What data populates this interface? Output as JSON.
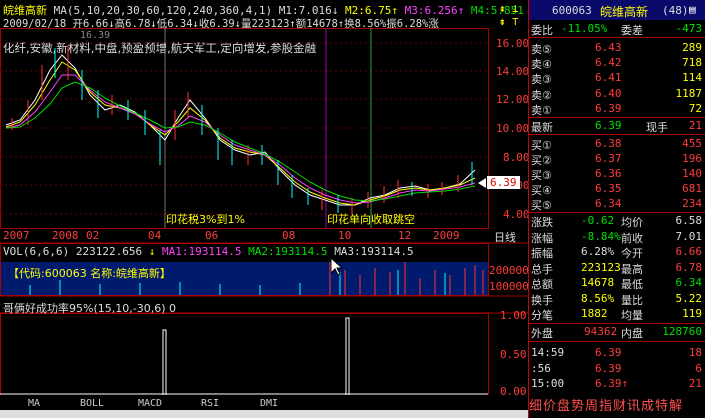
{
  "header": {
    "stock_name": "皖维高新",
    "ma_label": "MA(5,10,20,30,60,120,240,360,4,1)",
    "m1": "M1:7.016↓",
    "m2": "M2:6.75↑",
    "m3": "M3:6.256↑",
    "m4": "M4:5.851",
    "line2": "2009/02/18 开6.66↓高6.78↓低6.34↓收6.39↓量223123↑额14678↑换8.56%振6.28%涨"
  },
  "concepts": "化纤,安徽,新材料,中盘,预盈预增,航天军工,定向增发,参股金融",
  "chart_topbar_price": "16.39",
  "price_axis": [
    "16.00",
    "14.00",
    "12.00",
    "10.00",
    "8.00",
    "6.00",
    "4.00"
  ],
  "time_axis": [
    "2007",
    "2008",
    "02",
    "04",
    "06",
    "08",
    "10",
    "12",
    "2009"
  ],
  "time_axis_unit": "日线",
  "annotations": {
    "ann1": "印花税3%到1%",
    "ann2": "印花单向收取跳空"
  },
  "current_price_tag": "6.39",
  "vol": {
    "label": "VOL(6,6,6)",
    "value": "223122.656",
    "ma1": "MA1:193114.5",
    "ma2": "MA2:193114.5",
    "ma3": "MA3:193114.5",
    "info": "【代码:600063 名称:皖维高新】",
    "axis": [
      "200000",
      "100000"
    ]
  },
  "indicator": {
    "label": "哥俩好成功率95%(15,10,-30,6) 0",
    "axis": [
      "1.00",
      "0.50",
      "0.00"
    ]
  },
  "tabs": [
    "MA",
    "BOLL",
    "MACD",
    "RSI",
    "DMI"
  ],
  "quote": {
    "code": "600063",
    "name": "皖维高新",
    "count": "(48)",
    "weibi_label": "委比",
    "weibi_value": "-11.05%",
    "weicha_label": "委差",
    "weicha_value": "-473",
    "asks": [
      {
        "label": "卖⑤",
        "price": "6.43",
        "vol": "289"
      },
      {
        "label": "卖④",
        "price": "6.42",
        "vol": "718"
      },
      {
        "label": "卖③",
        "price": "6.41",
        "vol": "114"
      },
      {
        "label": "卖②",
        "price": "6.40",
        "vol": "1187"
      },
      {
        "label": "卖①",
        "price": "6.39",
        "vol": "72"
      }
    ],
    "last_label": "最新",
    "last_price": "6.39",
    "now_label": "现手",
    "now_vol": "21",
    "bids": [
      {
        "label": "买①",
        "price": "6.38",
        "vol": "455"
      },
      {
        "label": "买②",
        "price": "6.37",
        "vol": "196"
      },
      {
        "label": "买③",
        "price": "6.36",
        "vol": "140"
      },
      {
        "label": "买④",
        "price": "6.35",
        "vol": "681"
      },
      {
        "label": "买⑤",
        "price": "6.34",
        "vol": "234"
      }
    ],
    "stats": [
      {
        "l1": "涨跌",
        "v1": "-0.62",
        "l2": "均价",
        "v2": "6.58"
      },
      {
        "l1": "涨幅",
        "v1": "-8.84%",
        "l2": "前收",
        "v2": "7.01"
      },
      {
        "l1": "振幅",
        "v1": "6.28%",
        "l2": "今开",
        "v2": "6.66"
      },
      {
        "l1": "总手",
        "v1": "223123",
        "l2": "最高",
        "v2": "6.78"
      },
      {
        "l1": "总额",
        "v1": "14678",
        "l2": "最低",
        "v2": "6.34"
      },
      {
        "l1": "换手",
        "v1": "8.56%",
        "l2": "量比",
        "v2": "5.22"
      },
      {
        "l1": "分笔",
        "v1": "1882",
        "l2": "均量",
        "v2": "119"
      }
    ],
    "outer_label": "外盘",
    "outer": "94362",
    "inner_label": "内盘",
    "inner": "128760",
    "ticks": [
      {
        "time": "14:59",
        "price": "6.39",
        "vol": "18"
      },
      {
        "time": ":56",
        "price": "6.39",
        "vol": "6"
      },
      {
        "time": "15:00",
        "price": "6.39↑",
        "vol": "21"
      }
    ],
    "bottom_bar": "细价盘势周指财讯成特解"
  }
}
